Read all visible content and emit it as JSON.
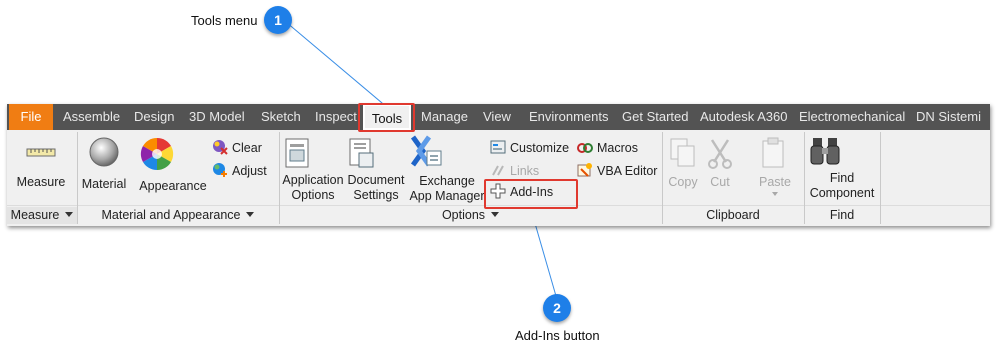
{
  "callouts": [
    {
      "number": "1",
      "label": "Tools menu"
    },
    {
      "number": "2",
      "label": "Add-Ins button"
    }
  ],
  "tabs": [
    {
      "label": "File"
    },
    {
      "label": "Assemble"
    },
    {
      "label": "Design"
    },
    {
      "label": "3D Model"
    },
    {
      "label": "Sketch"
    },
    {
      "label": "Inspect"
    },
    {
      "label": "Tools"
    },
    {
      "label": "Manage"
    },
    {
      "label": "View"
    },
    {
      "label": "Environments"
    },
    {
      "label": "Get Started"
    },
    {
      "label": "Autodesk A360"
    },
    {
      "label": "Electromechanical"
    },
    {
      "label": "DN Sistemi"
    }
  ],
  "active_tab": "Tools",
  "panels": {
    "measure": {
      "title": "Measure",
      "measure_label": "Measure"
    },
    "material_appearance": {
      "title": "Material and Appearance",
      "material_label": "Material",
      "appearance_label": "Appearance",
      "clear_label": "Clear",
      "adjust_label": "Adjust"
    },
    "options": {
      "title": "Options",
      "application_options_line1": "Application",
      "application_options_line2": "Options",
      "document_settings_line1": "Document",
      "document_settings_line2": "Settings",
      "exchange_line1": "Exchange",
      "exchange_line2": "App Manager",
      "customize_label": "Customize",
      "links_label": "Links",
      "addins_label": "Add-Ins",
      "macros_label": "Macros",
      "vba_editor_label": "VBA Editor"
    },
    "clipboard": {
      "title": "Clipboard",
      "copy_label": "Copy",
      "cut_label": "Cut",
      "paste_label": "Paste"
    },
    "find": {
      "title": "Find",
      "find_line1": "Find",
      "find_line2": "Component"
    }
  },
  "colors": {
    "accent_file_tab": "#f07d13",
    "highlight_box": "#e0392f",
    "callout_badge": "#1e7fe8",
    "tab_bar": "#535353"
  }
}
